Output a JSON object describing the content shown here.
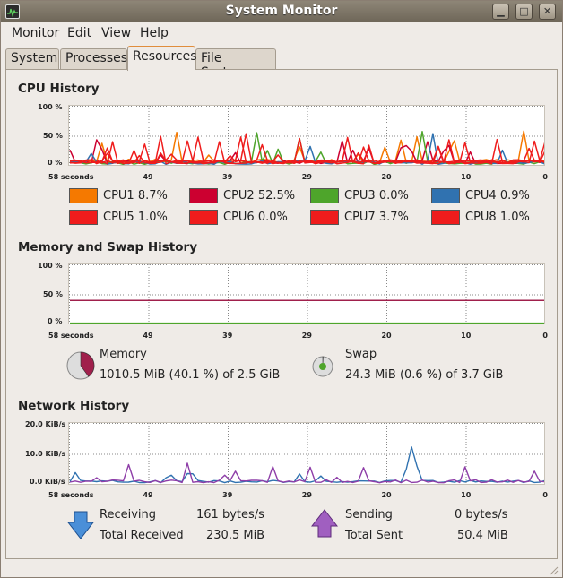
{
  "window": {
    "title": "System Monitor"
  },
  "menu": [
    "Monitor",
    "Edit",
    "View",
    "Help"
  ],
  "tabs": [
    "System",
    "Processes",
    "Resources",
    "File Systems"
  ],
  "active_tab": "Resources",
  "x_ticks": [
    "58 seconds",
    "49",
    "39",
    "29",
    "20",
    "10",
    "0"
  ],
  "cpu": {
    "title": "CPU History",
    "y_ticks": [
      "100 %",
      "50 %",
      "0 %"
    ],
    "legend": [
      {
        "name": "CPU1",
        "value": "8.7%",
        "color": "#f57900"
      },
      {
        "name": "CPU2",
        "value": "52.5%",
        "color": "#cc0030"
      },
      {
        "name": "CPU3",
        "value": "0.0%",
        "color": "#4ea52b"
      },
      {
        "name": "CPU4",
        "value": "0.9%",
        "color": "#3072b0"
      },
      {
        "name": "CPU5",
        "value": "1.0%",
        "color": "#ef1c1c"
      },
      {
        "name": "CPU6",
        "value": "0.0%",
        "color": "#ef1c1c"
      },
      {
        "name": "CPU7",
        "value": "3.7%",
        "color": "#ef1c1c"
      },
      {
        "name": "CPU8",
        "value": "1.0%",
        "color": "#ef1c1c"
      }
    ]
  },
  "memory": {
    "title": "Memory and Swap History",
    "y_ticks": [
      "100 %",
      "50 %",
      "0 %"
    ],
    "memory_label": "Memory",
    "memory_value": "1010.5 MiB (40.1 %) of 2.5 GiB",
    "memory_fraction": 0.401,
    "memory_color": "#a0204c",
    "swap_label": "Swap",
    "swap_value": "24.3 MiB (0.6 %) of 3.7 GiB",
    "swap_fraction": 0.006,
    "swap_color": "#4ea52b"
  },
  "network": {
    "title": "Network History",
    "y_ticks": [
      "20.0 KiB/s",
      "10.0 KiB/s",
      "0.0 KiB/s"
    ],
    "receiving_label": "Receiving",
    "receiving_value": "161 bytes/s",
    "total_received_label": "Total Received",
    "total_received_value": "230.5 MiB",
    "sending_label": "Sending",
    "sending_value": "0 bytes/s",
    "total_sent_label": "Total Sent",
    "total_sent_value": "50.4 MiB",
    "receive_color": "#3072b0",
    "send_color": "#8e3ea8"
  }
}
